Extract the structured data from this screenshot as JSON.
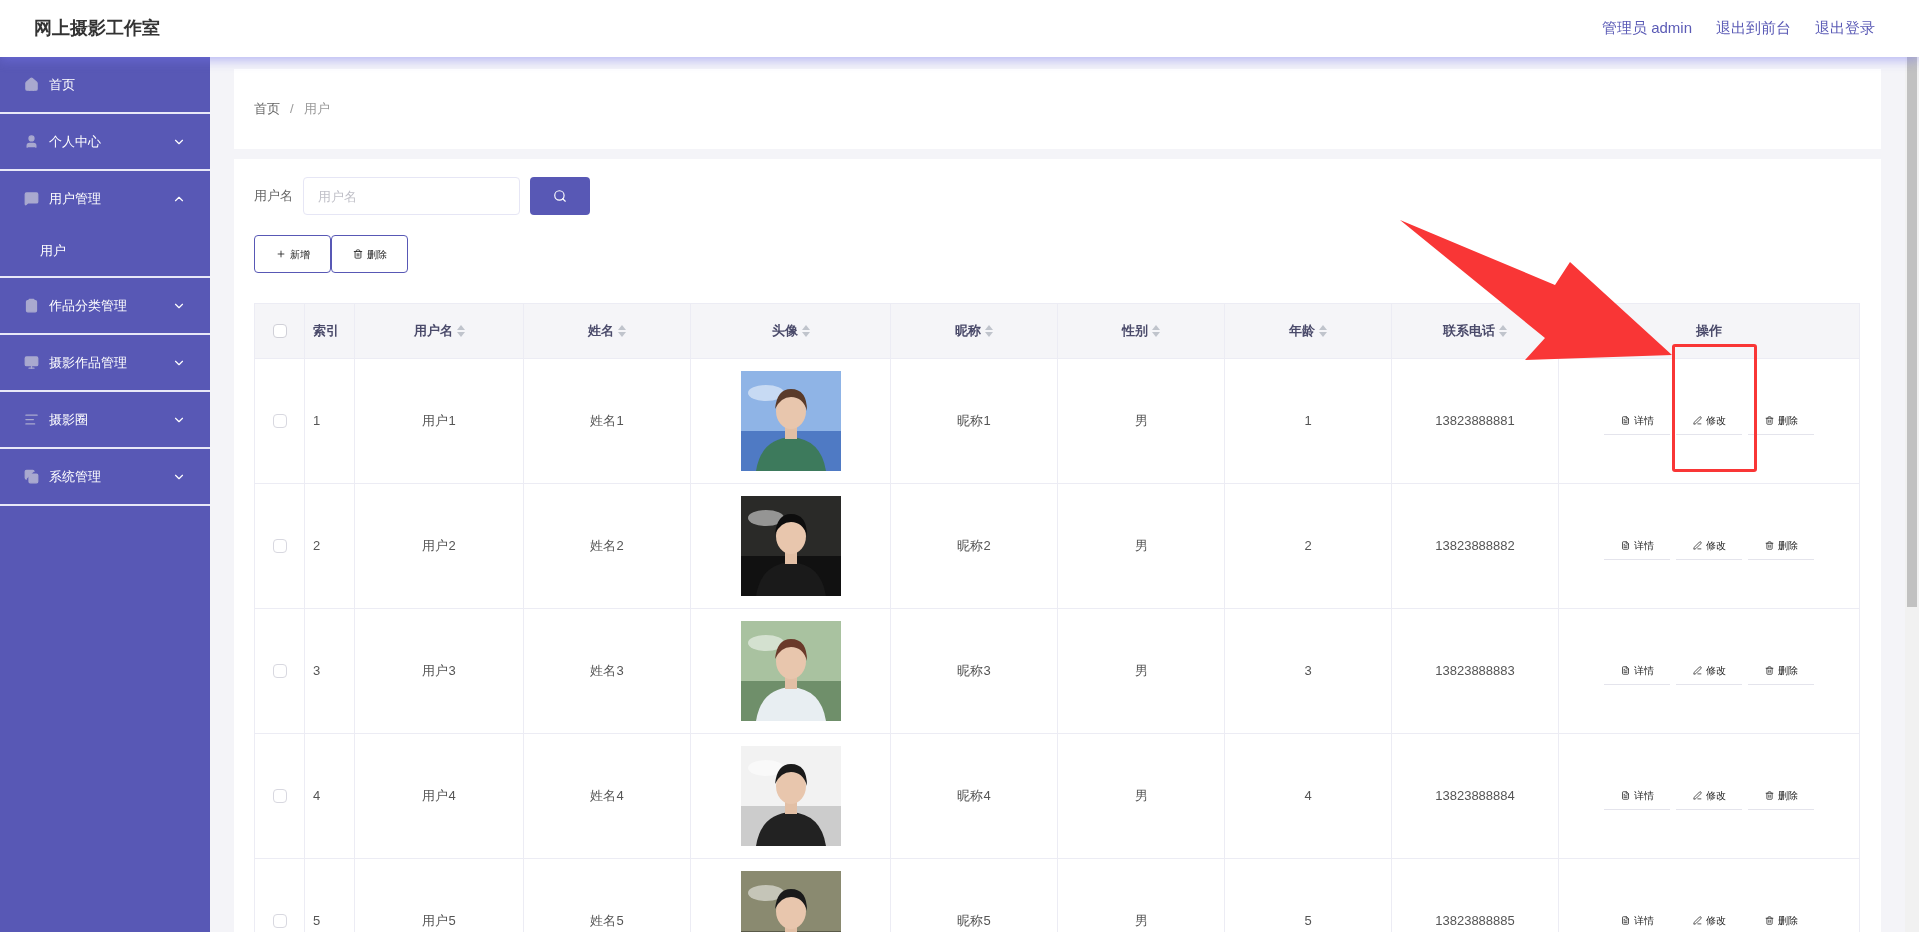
{
  "header": {
    "title": "网上摄影工作室",
    "links": [
      "管理员 admin",
      "退出到前台",
      "退出登录"
    ]
  },
  "sidebar": {
    "items": [
      {
        "label": "首页",
        "kind": "link"
      },
      {
        "label": "个人中心",
        "kind": "group",
        "expanded": false
      },
      {
        "label": "用户管理",
        "kind": "group",
        "expanded": true,
        "children": [
          {
            "label": "用户"
          }
        ]
      },
      {
        "label": "作品分类管理",
        "kind": "group",
        "expanded": false
      },
      {
        "label": "摄影作品管理",
        "kind": "group",
        "expanded": false
      },
      {
        "label": "摄影圈",
        "kind": "group",
        "expanded": false
      },
      {
        "label": "系统管理",
        "kind": "group",
        "expanded": false
      }
    ]
  },
  "breadcrumb": [
    "首页",
    "/",
    "用户"
  ],
  "search": {
    "label": "用户名",
    "placeholder": "用户名"
  },
  "toolbar": [
    "新增",
    "删除"
  ],
  "table": {
    "select_all": {
      "checked": false
    },
    "columns": [
      {
        "label": "索引",
        "sortable": false
      },
      {
        "label": "用户名",
        "sortable": true
      },
      {
        "label": "姓名",
        "sortable": true
      },
      {
        "label": "头像",
        "sortable": true
      },
      {
        "label": "昵称",
        "sortable": true
      },
      {
        "label": "性别",
        "sortable": true
      },
      {
        "label": "年龄",
        "sortable": true
      },
      {
        "label": "联系电话",
        "sortable": true
      },
      {
        "label": "操作",
        "sortable": false
      }
    ],
    "rows": [
      {
        "checked": false,
        "cells": [
          "1",
          "用户1",
          "姓名1",
          {
            "kind": "picture"
          },
          "昵称1",
          "男",
          "1",
          "13823888881"
        ],
        "actions": [
          "详情",
          "修改",
          "删除"
        ]
      },
      {
        "checked": false,
        "cells": [
          "2",
          "用户2",
          "姓名2",
          {
            "kind": "picture"
          },
          "昵称2",
          "男",
          "2",
          "13823888882"
        ],
        "actions": [
          "详情",
          "修改",
          "删除"
        ]
      },
      {
        "checked": false,
        "cells": [
          "3",
          "用户3",
          "姓名3",
          {
            "kind": "picture"
          },
          "昵称3",
          "男",
          "3",
          "13823888883"
        ],
        "actions": [
          "详情",
          "修改",
          "删除"
        ]
      },
      {
        "checked": false,
        "cells": [
          "4",
          "用户4",
          "姓名4",
          {
            "kind": "picture"
          },
          "昵称4",
          "男",
          "4",
          "13823888884"
        ],
        "actions": [
          "详情",
          "修改",
          "删除"
        ]
      },
      {
        "checked": false,
        "cells": [
          "5",
          "用户5",
          "姓名5",
          {
            "kind": "picture"
          },
          "昵称5",
          "男",
          "5",
          "13823888885"
        ],
        "actions": [
          "详情",
          "修改",
          "删除"
        ]
      }
    ]
  },
  "annotation": {
    "arrow": true,
    "highlight": true
  }
}
